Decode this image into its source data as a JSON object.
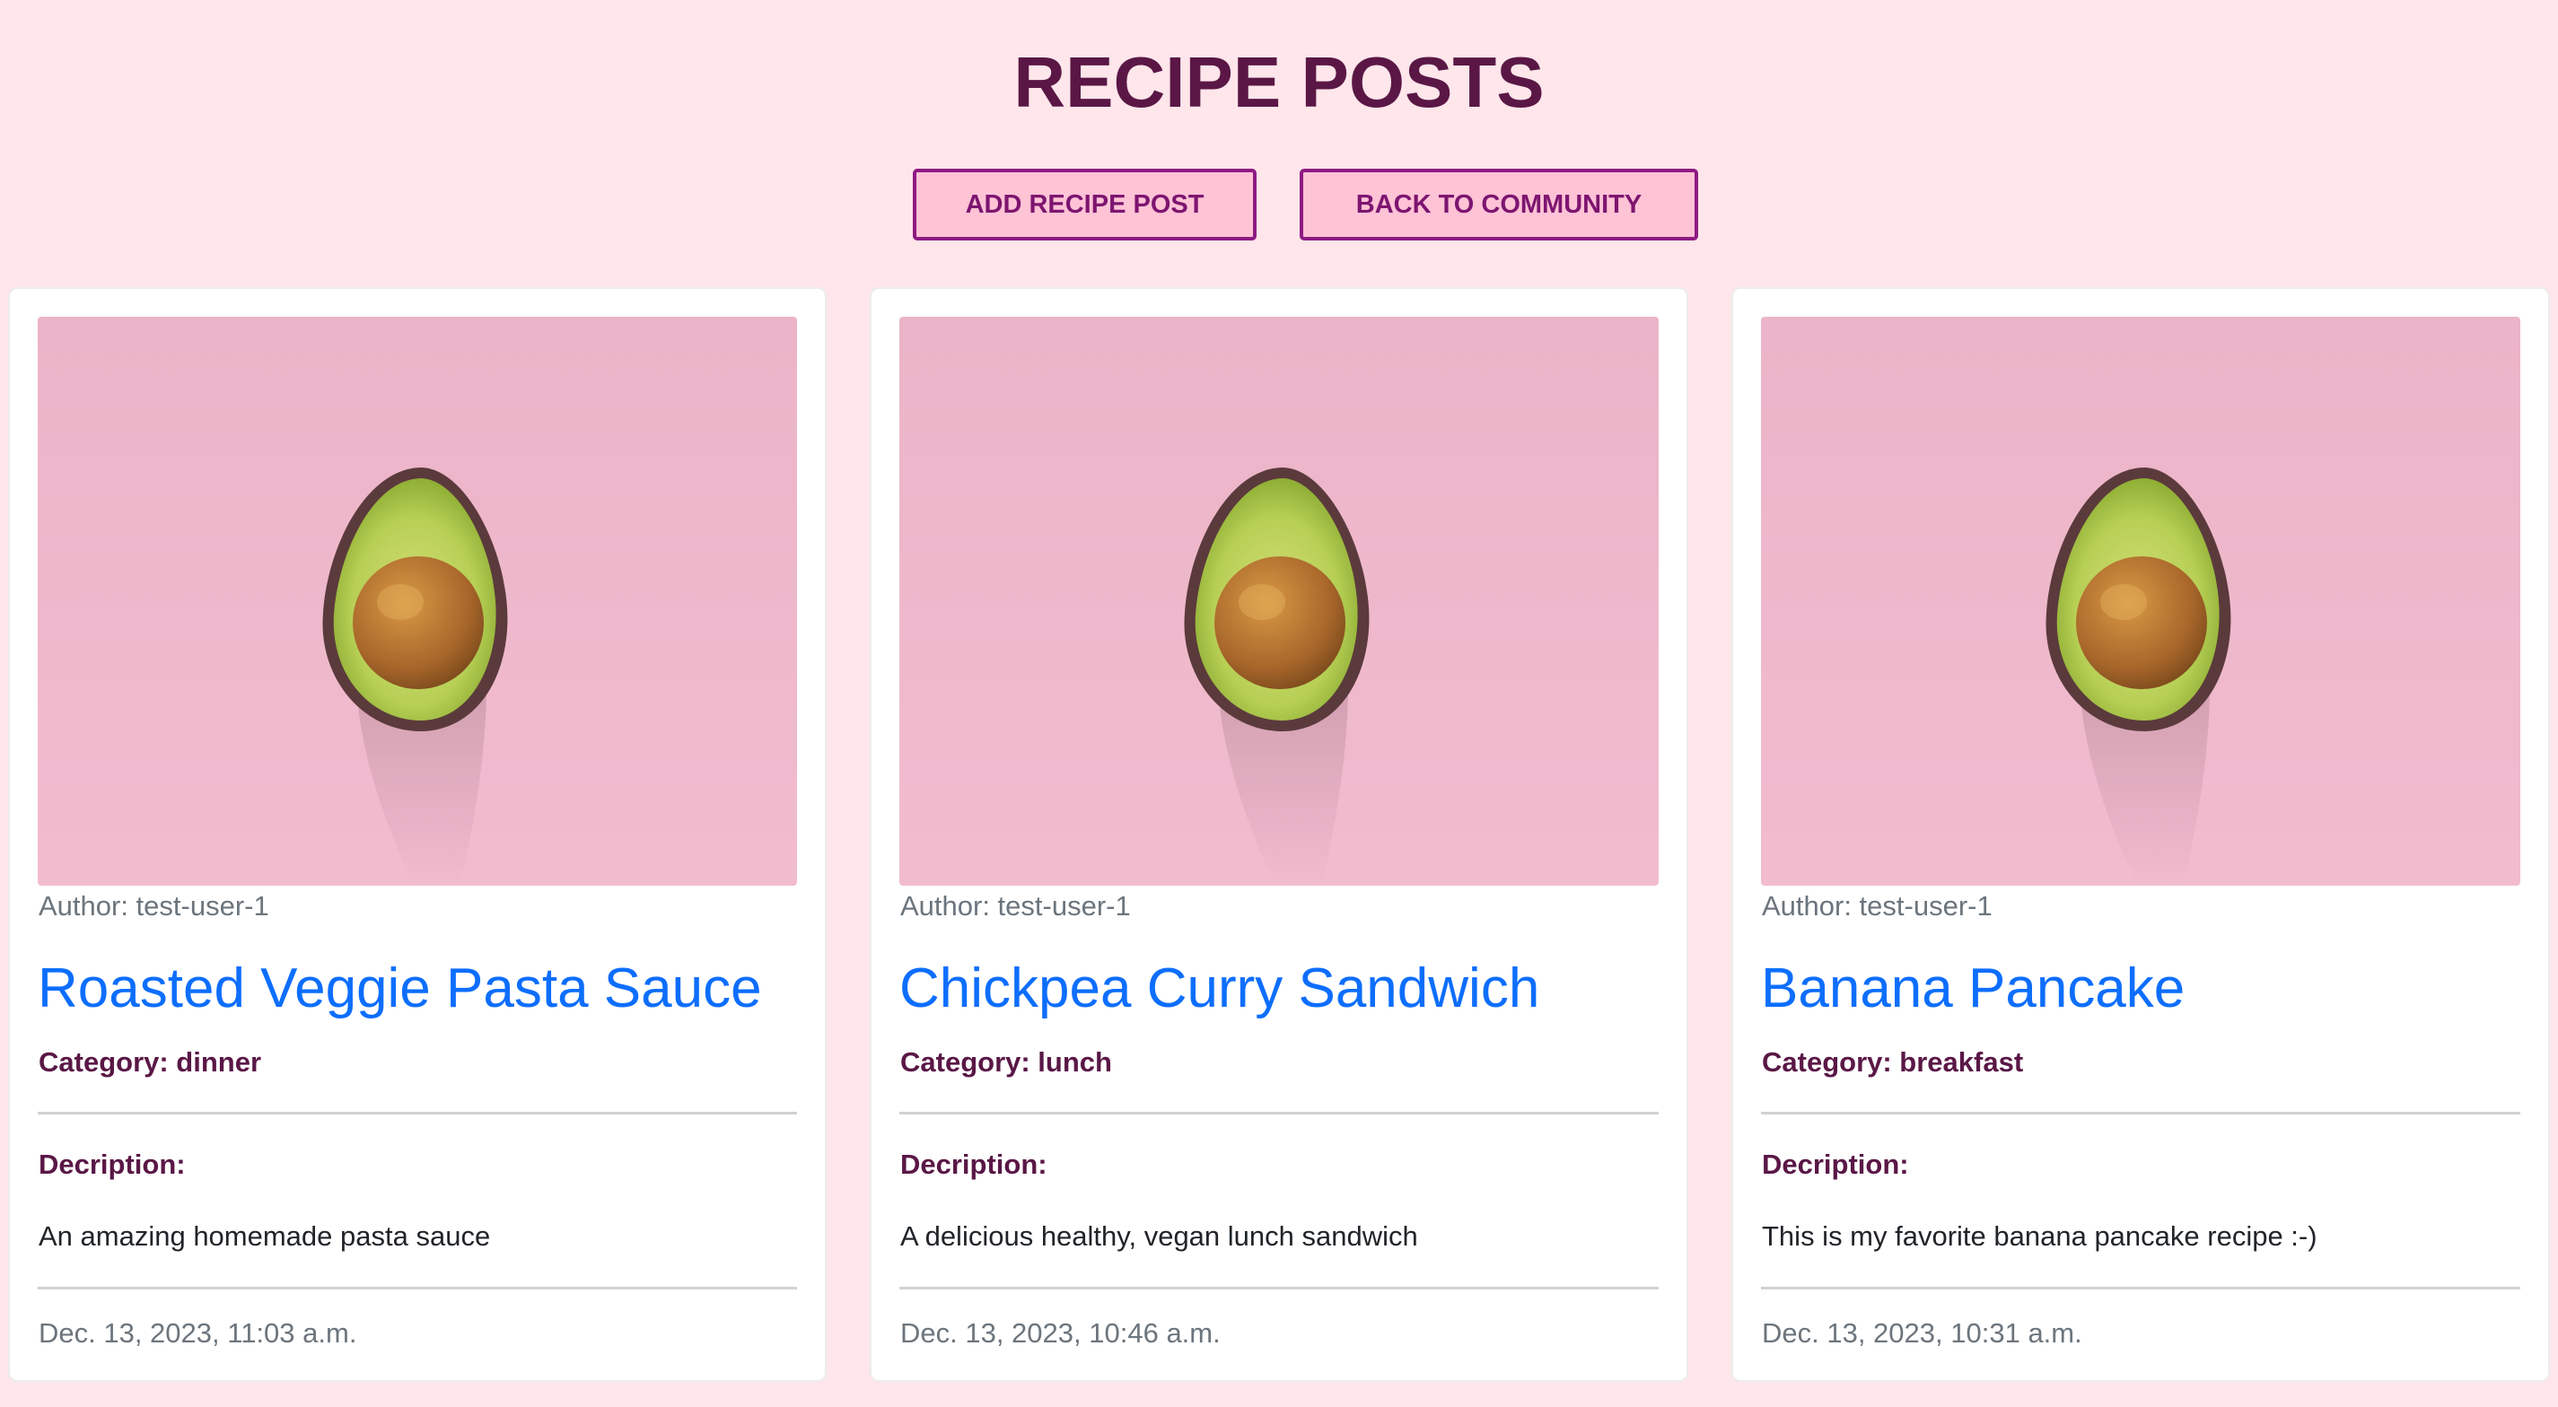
{
  "header": {
    "title": "RECIPE POSTS",
    "add_button": "ADD RECIPE POST",
    "back_button": "BACK TO COMMUNITY"
  },
  "posts": [
    {
      "author": "Author: test-user-1",
      "title": "Roasted Veggie Pasta Sauce",
      "category": "Category: dinner",
      "description_label": "Decription:",
      "description": "An amazing homemade pasta sauce",
      "date": "Dec. 13, 2023, 11:03 a.m."
    },
    {
      "author": "Author: test-user-1",
      "title": "Chickpea Curry Sandwich",
      "category": "Category: lunch",
      "description_label": "Decription:",
      "description": "A delicious healthy, vegan lunch sandwich",
      "date": "Dec. 13, 2023, 10:46 a.m."
    },
    {
      "author": "Author: test-user-1",
      "title": "Banana Pancake",
      "category": "Category: breakfast",
      "description_label": "Decription:",
      "description": "This is my favorite banana pancake recipe :-)",
      "date": "Dec. 13, 2023, 10:31 a.m."
    }
  ],
  "colors": {
    "page_background": "#ffe6ea",
    "title": "#5a1746",
    "button_background": "#ffc3d6",
    "button_border": "#8e1a82",
    "link": "#0d6efd",
    "muted_text": "#6c757d",
    "image_background": "#f0b8cb"
  }
}
